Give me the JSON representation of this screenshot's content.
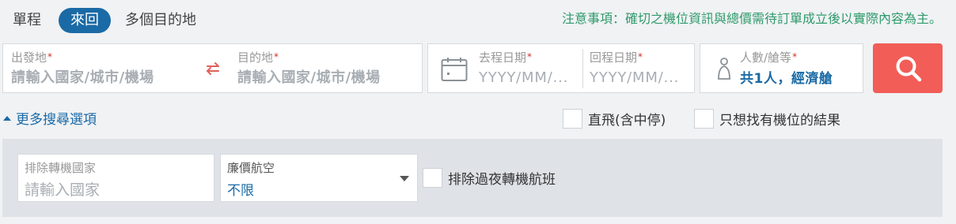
{
  "trip_type": {
    "one_way": "單程",
    "round_trip": "來回",
    "multi_city": "多個目的地"
  },
  "notice": "注意事項：確切之機位資訊與總價需待訂單成立後以實際內容為主。",
  "route": {
    "origin_label": "出發地",
    "origin_placeholder": "請輸入國家/城市/機場",
    "dest_label": "目的地",
    "dest_placeholder": "請輸入國家/城市/機場",
    "required_mark": "*"
  },
  "dates": {
    "departure_label": "去程日期",
    "departure_placeholder": "YYYY/MM/...",
    "return_label": "回程日期",
    "return_placeholder": "YYYY/MM/..."
  },
  "passengers": {
    "label": "人數/艙等",
    "value": "共1人，經濟艙"
  },
  "more_options": {
    "toggle_label": "更多搜尋選項",
    "direct_label": "直飛(含中停)",
    "seats_only_label": "只想找有機位的結果"
  },
  "advanced": {
    "exclude_transit_label": "排除轉機國家",
    "exclude_transit_placeholder": "請輸入國家",
    "lcc_label": "廉價航空",
    "lcc_value": "不限",
    "exclude_overnight_label": "排除過夜轉機航班"
  },
  "colors": {
    "accent_blue": "#1a6aa6",
    "search_button": "#f25d57",
    "notice_green": "#2f9a6b",
    "required_red": "#d0312d"
  }
}
